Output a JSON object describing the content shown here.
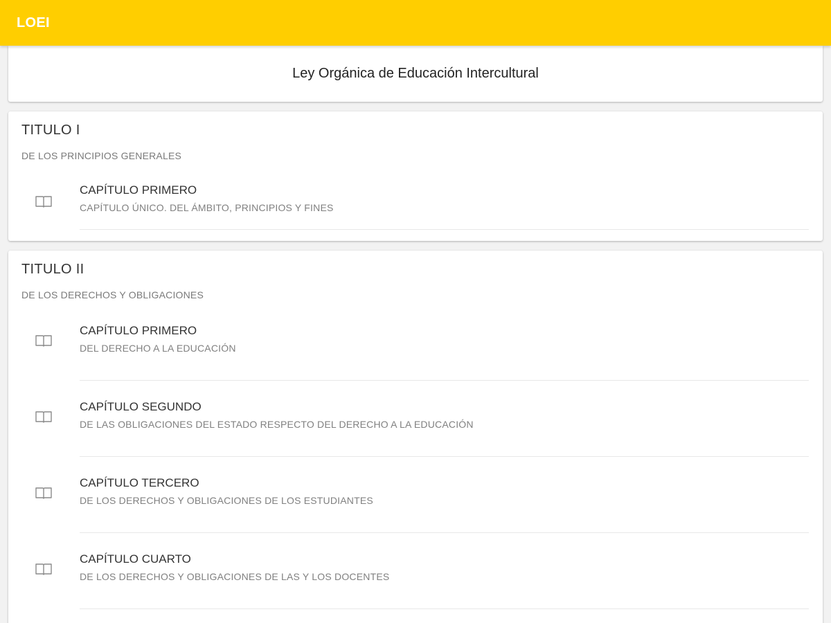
{
  "toolbar": {
    "title": "LOEI",
    "background_color": "#ffce00"
  },
  "header": {
    "text": "Ley Orgánica de Educación Intercultural"
  },
  "titulos": [
    {
      "title": "TITULO I",
      "subtitle": "DE LOS PRINCIPIOS GENERALES",
      "chapters": [
        {
          "icon": "book-icon",
          "label": "CAPÍTULO PRIMERO",
          "description": "CAPÍTULO ÚNICO. DEL ÁMBITO, PRINCIPIOS Y FINES"
        }
      ]
    },
    {
      "title": "TITULO II",
      "subtitle": "DE LOS DERECHOS Y OBLIGACIONES",
      "chapters": [
        {
          "icon": "book-icon",
          "label": "CAPÍTULO PRIMERO",
          "description": "DEL DERECHO A LA EDUCACIÓN"
        },
        {
          "icon": "book-icon",
          "label": "CAPÍTULO SEGUNDO",
          "description": "DE LAS OBLIGACIONES DEL ESTADO RESPECTO DEL DERECHO A LA EDUCACIÓN"
        },
        {
          "icon": "book-icon",
          "label": "CAPÍTULO TERCERO",
          "description": "DE LOS DERECHOS Y OBLIGACIONES DE LOS ESTUDIANTES"
        },
        {
          "icon": "book-icon",
          "label": "CAPÍTULO CUARTO",
          "description": "DE LOS DERECHOS Y OBLIGACIONES DE LAS Y LOS DOCENTES"
        }
      ]
    }
  ]
}
